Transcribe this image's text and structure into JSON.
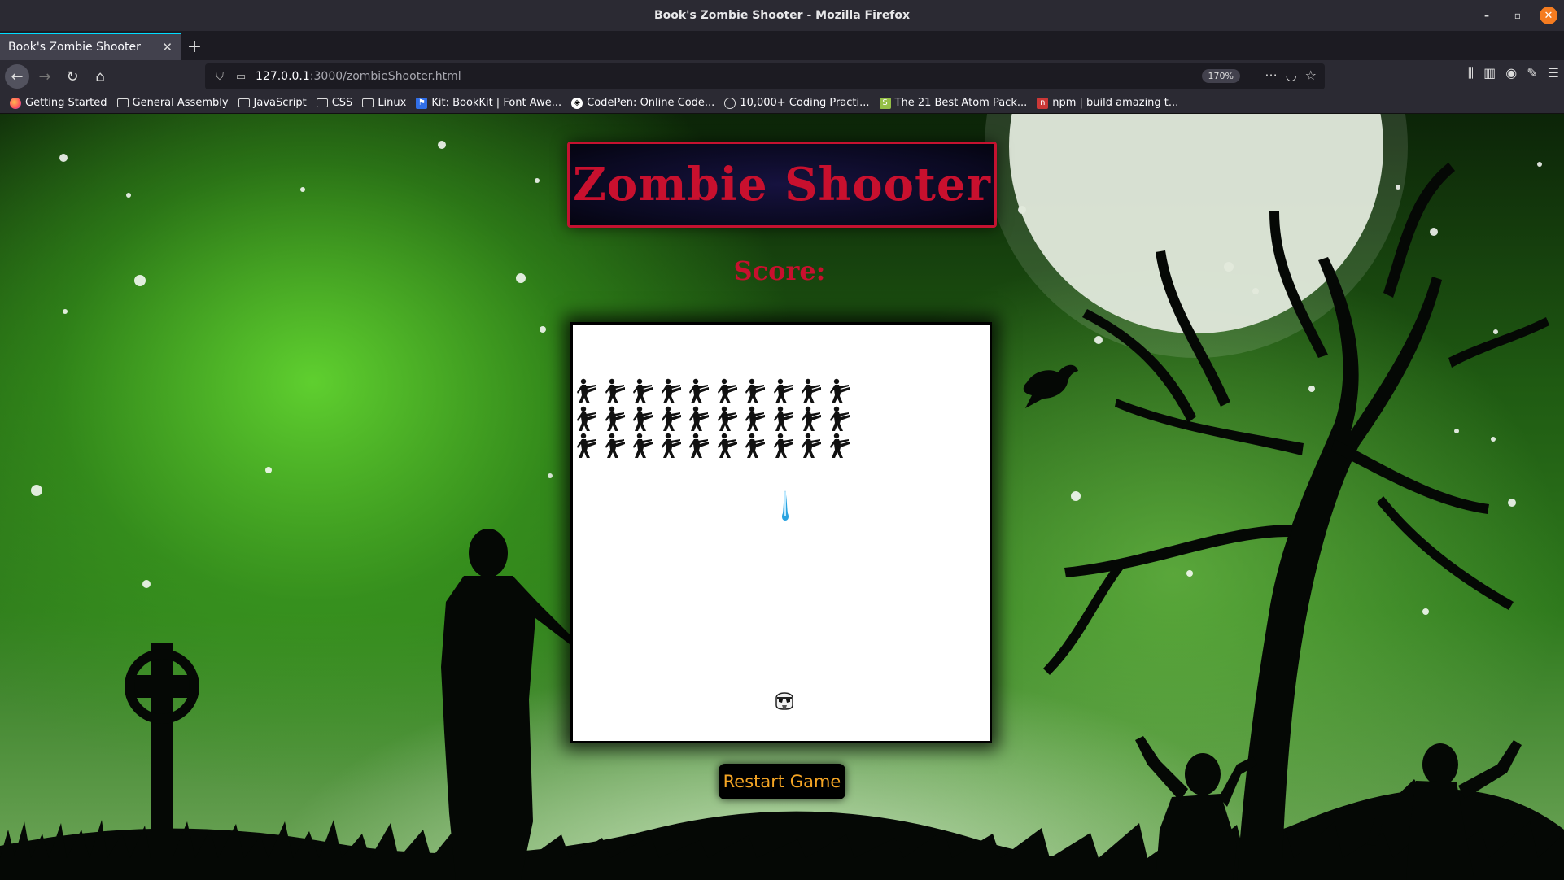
{
  "window": {
    "title": "Book's Zombie Shooter - Mozilla Firefox",
    "controls": {
      "minimize_icon": "–",
      "maximize_icon": "▫",
      "close_icon": "✕"
    }
  },
  "tabs": [
    {
      "label": "Book's Zombie Shooter",
      "active": true
    }
  ],
  "toolbar": {
    "url_host": "127.0.0.1",
    "url_rest": ":3000/zombieShooter.html",
    "zoom": "170%",
    "icons": [
      "back-icon",
      "forward-icon",
      "reload-icon",
      "home-icon",
      "shield-icon",
      "page-icon",
      "more-icon",
      "pocket-icon",
      "bookmark-star-icon",
      "library-icon",
      "sidebar-icon",
      "account-icon",
      "extension-icon",
      "menu-icon"
    ]
  },
  "bookmarks": [
    {
      "label": "Getting Started",
      "icon": "firefox"
    },
    {
      "label": "General Assembly",
      "icon": "folder"
    },
    {
      "label": "JavaScript",
      "icon": "folder"
    },
    {
      "label": "CSS",
      "icon": "folder"
    },
    {
      "label": "Linux",
      "icon": "folder"
    },
    {
      "label": "Kit: BookKit | Font Awe...",
      "icon": "kit"
    },
    {
      "label": "CodePen: Online Code...",
      "icon": "codepen"
    },
    {
      "label": "10,000+ Coding Practi...",
      "icon": "globe"
    },
    {
      "label": "The 21 Best Atom Pack...",
      "icon": "shopify"
    },
    {
      "label": "npm | build amazing t...",
      "icon": "npm"
    }
  ],
  "game": {
    "title": "Zombie Shooter",
    "score_label": "Score:",
    "score_value": "",
    "restart_label": "Restart Game",
    "zombie_rows": 3,
    "zombie_cols": 10,
    "colors": {
      "title": "#c8102e",
      "button_text": "#f5a524",
      "board": "#ffffff",
      "laser": "#29a3e0"
    }
  }
}
